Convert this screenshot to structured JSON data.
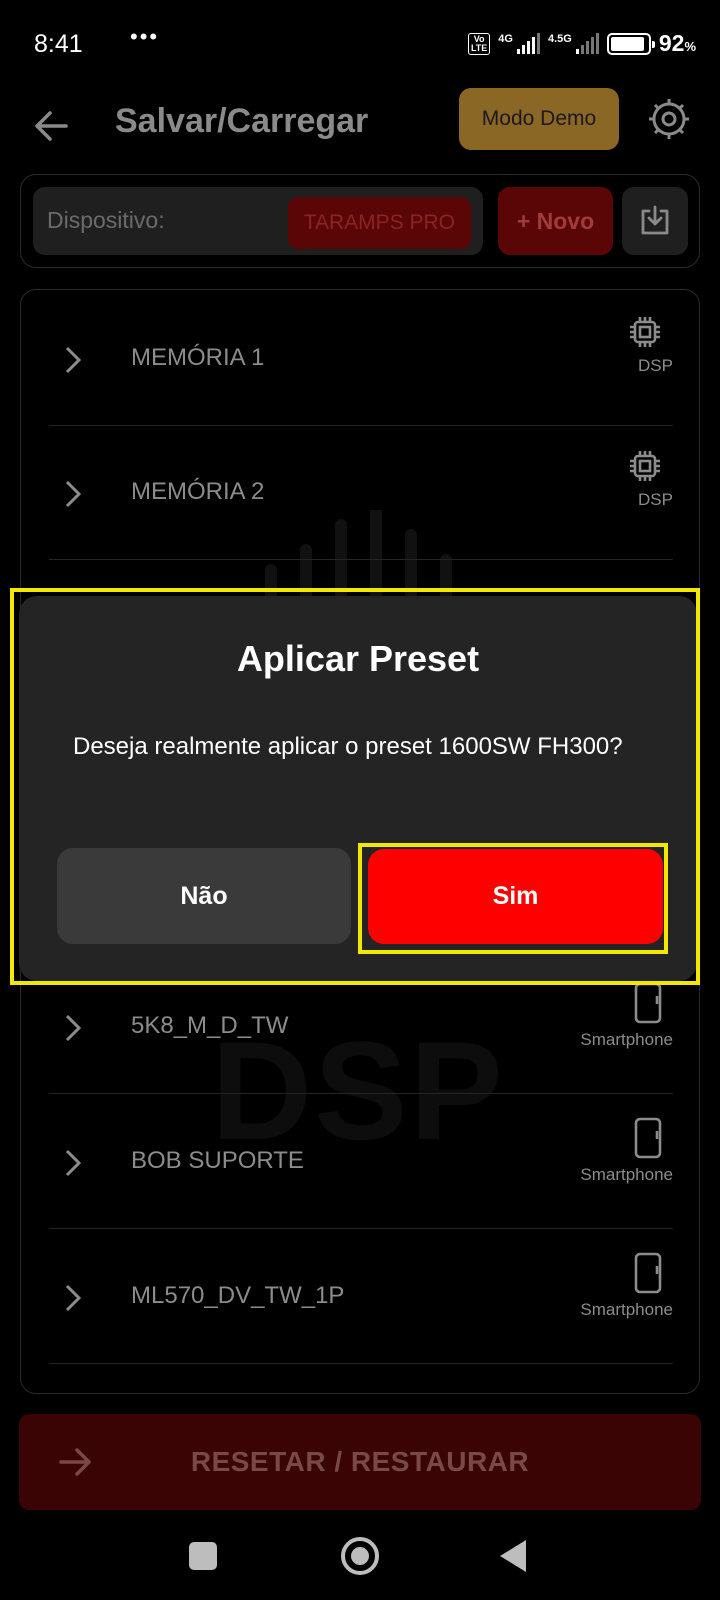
{
  "status_bar": {
    "time": "8:41",
    "dots": "•••",
    "volte": "Vo LTE",
    "net1": "4G",
    "net2": "4.5G",
    "battery_pct": "92",
    "battery_unit": "%",
    "battery_level": 0.92
  },
  "app_bar": {
    "title": "Salvar/Carregar",
    "demo_label": "Modo Demo",
    "back_icon": "arrow-left-icon",
    "settings_icon": "gear-icon"
  },
  "device": {
    "label": "Dispositivo:",
    "value": "TARAMPS PRO",
    "new_label": "+ Novo",
    "import_icon": "download-icon"
  },
  "presets": [
    {
      "label": "MEMÓRIA 1",
      "type": "DSP",
      "icon": "chip-icon"
    },
    {
      "label": "MEMÓRIA 2",
      "type": "DSP",
      "icon": "chip-icon"
    },
    {
      "label": "5K8_M_D_TW",
      "type": "Smartphone",
      "icon": "smartphone-icon"
    },
    {
      "label": "BOB SUPORTE",
      "type": "Smartphone",
      "icon": "smartphone-icon"
    },
    {
      "label": "ML570_DV_TW_1P",
      "type": "Smartphone",
      "icon": "smartphone-icon"
    }
  ],
  "watermark": "DSP",
  "reset": {
    "label": "RESETAR / RESTAURAR"
  },
  "dialog": {
    "title": "Aplicar Preset",
    "message": "Deseja realmente aplicar o preset 1600SW FH300?",
    "no_label": "Não",
    "yes_label": "Sim"
  },
  "colors": {
    "accent_red": "#ff0000",
    "highlight": "#f5e800",
    "demo_gold": "#8a6725"
  }
}
